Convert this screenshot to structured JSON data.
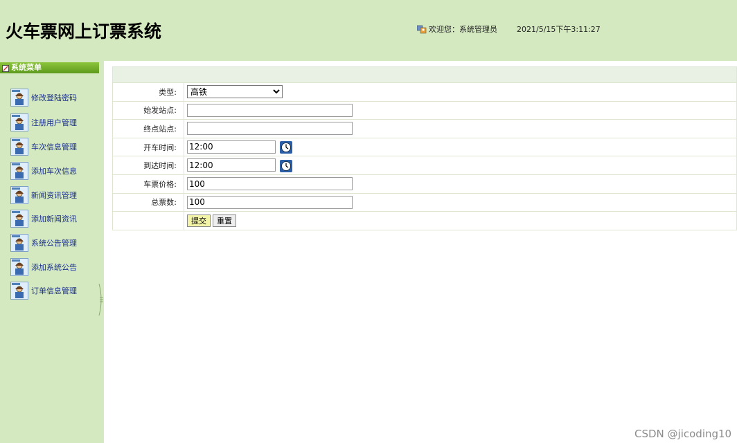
{
  "header": {
    "title": "火车票网上订票系统",
    "welcome": "欢迎您：系统管理员",
    "datetime": "2021/5/15下午3:11:27"
  },
  "sidebar": {
    "title": "系统菜单",
    "items": [
      {
        "label": "修改登陆密码"
      },
      {
        "label": "注册用户管理"
      },
      {
        "label": "车次信息管理"
      },
      {
        "label": "添加车次信息"
      },
      {
        "label": "新闻资讯管理"
      },
      {
        "label": "添加新闻资讯"
      },
      {
        "label": "系统公告管理"
      },
      {
        "label": "添加系统公告"
      },
      {
        "label": "订单信息管理"
      }
    ]
  },
  "form": {
    "type_label": "类型:",
    "type_value": "高铁",
    "start_label": "始发站点:",
    "start_value": "",
    "end_label": "终点站点:",
    "end_value": "",
    "depart_label": "开车时间:",
    "depart_value": "12:00",
    "arrive_label": "到达时间:",
    "arrive_value": "12:00",
    "price_label": "车票价格:",
    "price_value": "100",
    "total_label": "总票数:",
    "total_value": "100",
    "submit_label": "提交",
    "reset_label": "重置"
  },
  "watermark": "CSDN @jicoding10",
  "colors": {
    "header_bg": "#d4e9c0",
    "sidebar_bg": "#d4e9c0",
    "menu_title_bg": "#6ea82a",
    "menu_link": "#1a2f8c",
    "submit_bg": "#f4f4a8"
  },
  "icons": {
    "user": "user-icon",
    "menu_title": "edit-icon",
    "menu_item": "admin-avatar-icon",
    "time": "clock-icon"
  }
}
